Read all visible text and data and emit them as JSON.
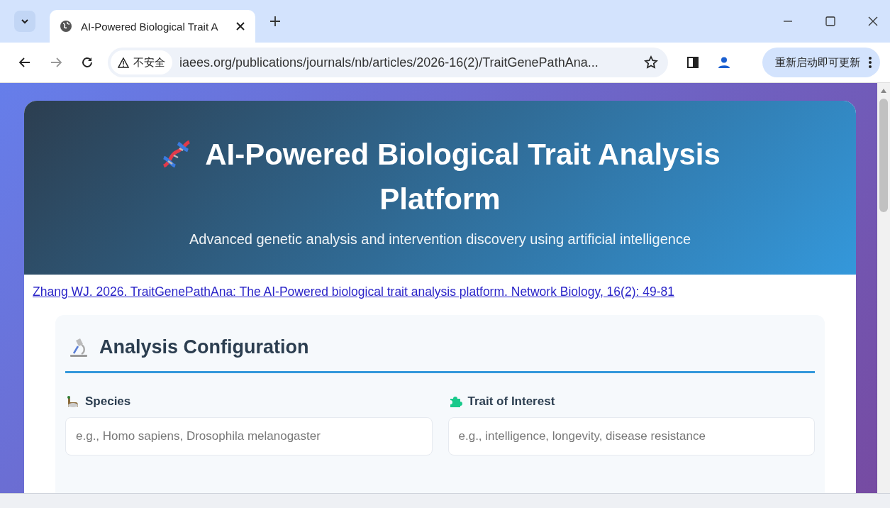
{
  "browser": {
    "tab": {
      "title": "AI-Powered Biological Trait A"
    },
    "security_label": "不安全",
    "url": "iaees.org/publications/journals/nb/articles/2026-16(2)/TraitGenePathAna...",
    "update_button": "重新启动即可更新"
  },
  "header": {
    "title": "AI-Powered Biological Trait Analysis Platform",
    "subtitle": "Advanced genetic analysis and intervention discovery using artificial intelligence"
  },
  "citation_link": "Zhang WJ. 2026. TraitGenePathAna: The AI-Powered biological trait analysis platform. Network Biology, 16(2): 49-81",
  "config": {
    "title": "Analysis Configuration",
    "fields": [
      {
        "kind": "species",
        "label": "Species",
        "placeholder": "e.g., Homo sapiens, Drosophila melanogaster"
      },
      {
        "kind": "trait",
        "label": "Trait of Interest",
        "placeholder": "e.g., intelligence, longevity, disease resistance"
      }
    ]
  }
}
